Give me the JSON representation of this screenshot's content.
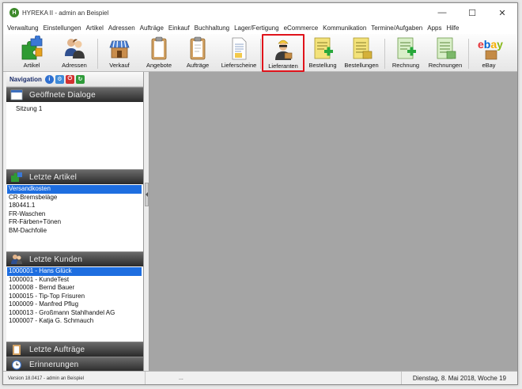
{
  "window": {
    "title": "HYREKA II - admin an Beispiel",
    "controls": {
      "minimize": "—",
      "maximize": "☐",
      "close": "✕"
    }
  },
  "menu": [
    "Verwaltung",
    "Einstellungen",
    "Artikel",
    "Adressen",
    "Aufträge",
    "Einkauf",
    "Buchhaltung",
    "Lager/Fertigung",
    "eCommerce",
    "Kommunikation",
    "Termine/Aufgaben",
    "Apps",
    "Hilfe"
  ],
  "toolbar": {
    "artikel": "Artikel",
    "adressen": "Adressen",
    "verkauf": "Verkauf",
    "angebote": "Angebote",
    "auftraege": "Aufträge",
    "lieferscheine": "Lieferscheine",
    "lieferanten": "Lieferanten",
    "bestellung": "Bestellung",
    "bestellungen": "Bestellungen",
    "rechnung": "Rechnung",
    "rechnungen": "Rechnungen",
    "ebay": "eBay",
    "ebay_logo": "ebay",
    "highlighted": "lieferanten"
  },
  "navigation": {
    "title": "Navigation",
    "sections": {
      "dialoge": {
        "title": "Geöffnete Dialoge",
        "items": [
          "Sitzung 1"
        ]
      },
      "artikel": {
        "title": "Letzte Artikel",
        "items": [
          "Versandkosten",
          "CR-Bremsbeläge",
          "180441.1",
          "FR-Waschen",
          "FR-Färben+Tönen",
          "BM-Dachfolie"
        ],
        "selected": 0
      },
      "kunden": {
        "title": "Letzte Kunden",
        "items": [
          "1000001 - Hans Glück",
          "1000001 - KundeTest",
          "1000008 - Bernd Bauer",
          "1000015 - Tip-Top Frisuren",
          "1000009 - Manfred Pflug",
          "1000013 - Großmann Stahlhandel AG",
          "1000007 - Katja G. Schmauch"
        ],
        "selected": 0
      },
      "auftraege": {
        "title": "Letzte Aufträge"
      },
      "erinnerungen": {
        "title": "Erinnerungen"
      }
    }
  },
  "status": {
    "version": "Version 18.0417 - admin an Beispiel",
    "middle": "...",
    "date": "Dienstag, 8. Mai 2018, Woche  19"
  },
  "colors": {
    "highlight_border": "#e0131b",
    "selection": "#1e6ee0",
    "workspace": "#a5a5a5",
    "section_header": "#2a2a2a"
  }
}
